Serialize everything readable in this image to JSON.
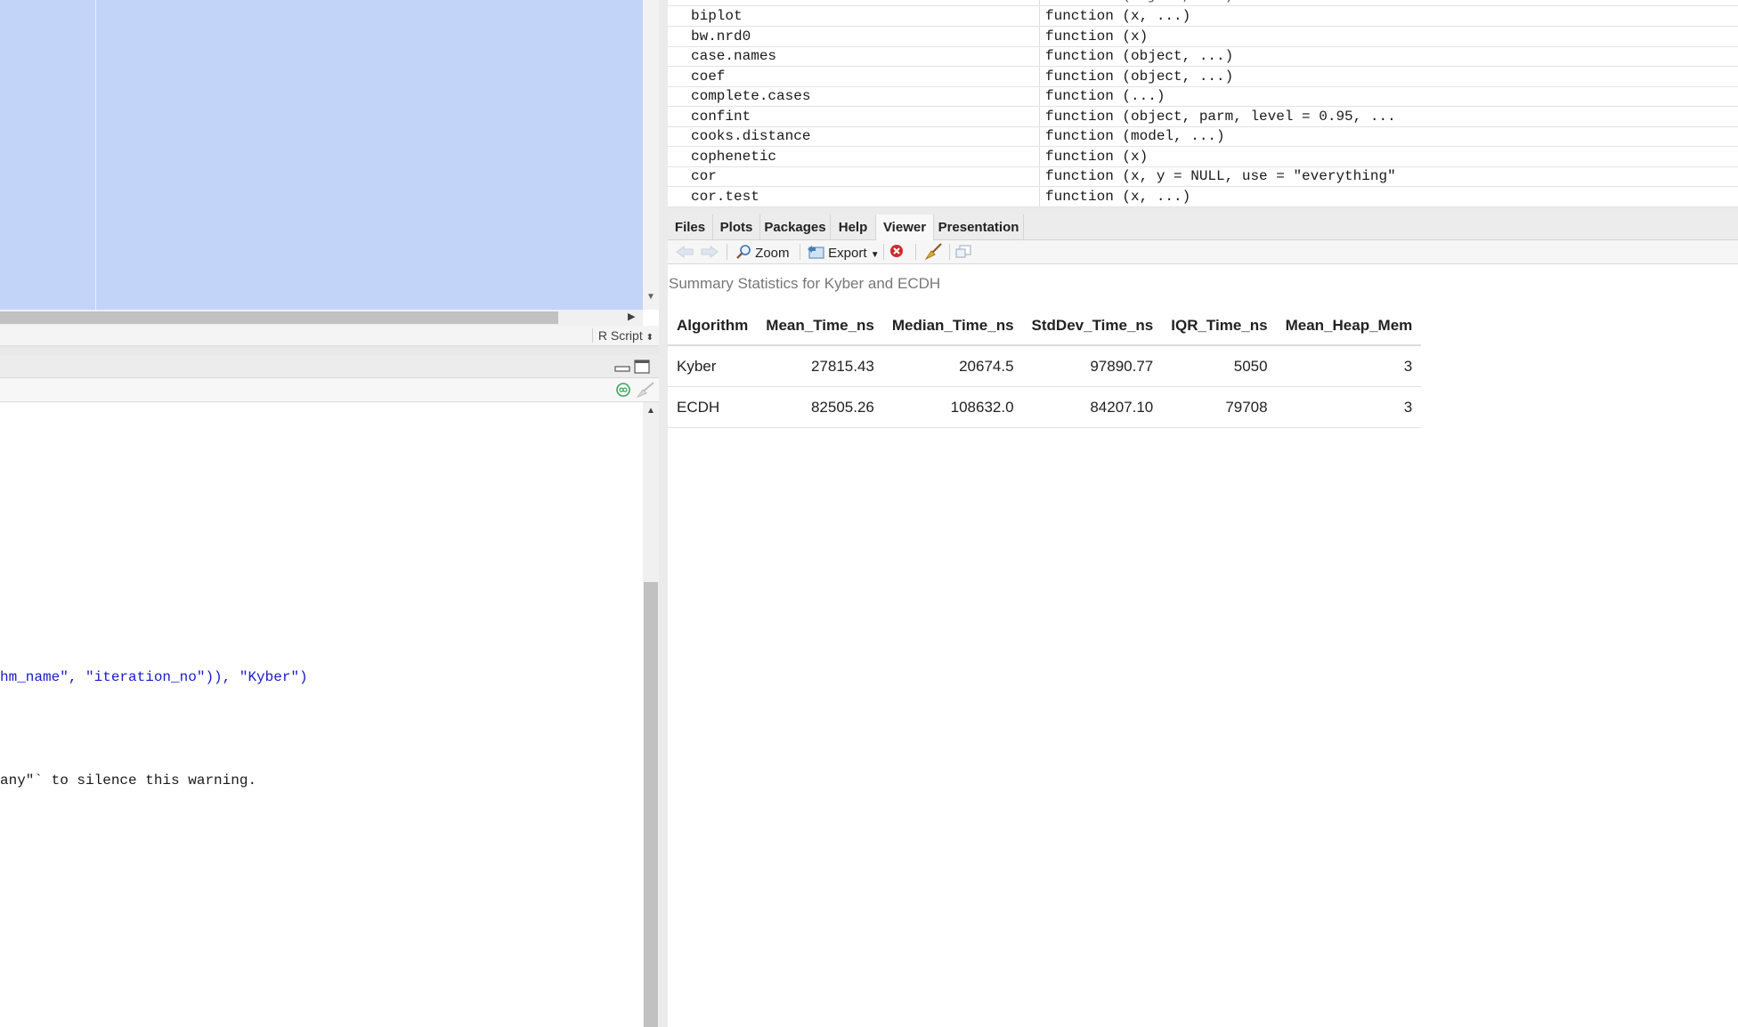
{
  "editor": {
    "file_type": "R Script"
  },
  "console": {
    "lines": [
      {
        "text": "hm_name\", \"iteration_no\")), \"Kyber\")",
        "color": "blue"
      },
      {
        "text": "any\"` to silence this warning.",
        "color": "dark"
      }
    ]
  },
  "environment": {
    "rows": [
      {
        "name": "biplot",
        "value": "function (x, ...)"
      },
      {
        "name": "bw.nrd0",
        "value": "function (x)"
      },
      {
        "name": "case.names",
        "value": "function (object, ...)"
      },
      {
        "name": "coef",
        "value": "function (object, ...)"
      },
      {
        "name": "complete.cases",
        "value": "function (...)"
      },
      {
        "name": "confint",
        "value": "function (object, parm, level = 0.95, ..."
      },
      {
        "name": "cooks.distance",
        "value": "function (model, ...)"
      },
      {
        "name": "cophenetic",
        "value": "function (x)"
      },
      {
        "name": "cor",
        "value": "function (x, y = NULL, use = \"everything\""
      },
      {
        "name": "cor.test",
        "value": "function (x, ...)"
      }
    ]
  },
  "tabs": [
    {
      "label": "Files",
      "active": false
    },
    {
      "label": "Plots",
      "active": false
    },
    {
      "label": "Packages",
      "active": false
    },
    {
      "label": "Help",
      "active": false
    },
    {
      "label": "Viewer",
      "active": true
    },
    {
      "label": "Presentation",
      "active": false
    }
  ],
  "viewer_toolbar": {
    "zoom_label": "Zoom",
    "export_label": "Export"
  },
  "viewer": {
    "caption": "Summary Statistics for Kyber and ECDH",
    "columns": [
      "Algorithm",
      "Mean_Time_ns",
      "Median_Time_ns",
      "StdDev_Time_ns",
      "IQR_Time_ns",
      "Mean_Heap_Mem"
    ],
    "rows": [
      [
        "Kyber",
        "27815.43",
        "20674.5",
        "97890.77",
        "5050",
        "3"
      ],
      [
        "ECDH",
        "82505.26",
        "108632.0",
        "84207.10",
        "79708",
        "3"
      ]
    ]
  },
  "colors": {
    "selection": "#c2d4f8",
    "code_blue": "#1a1acc"
  }
}
